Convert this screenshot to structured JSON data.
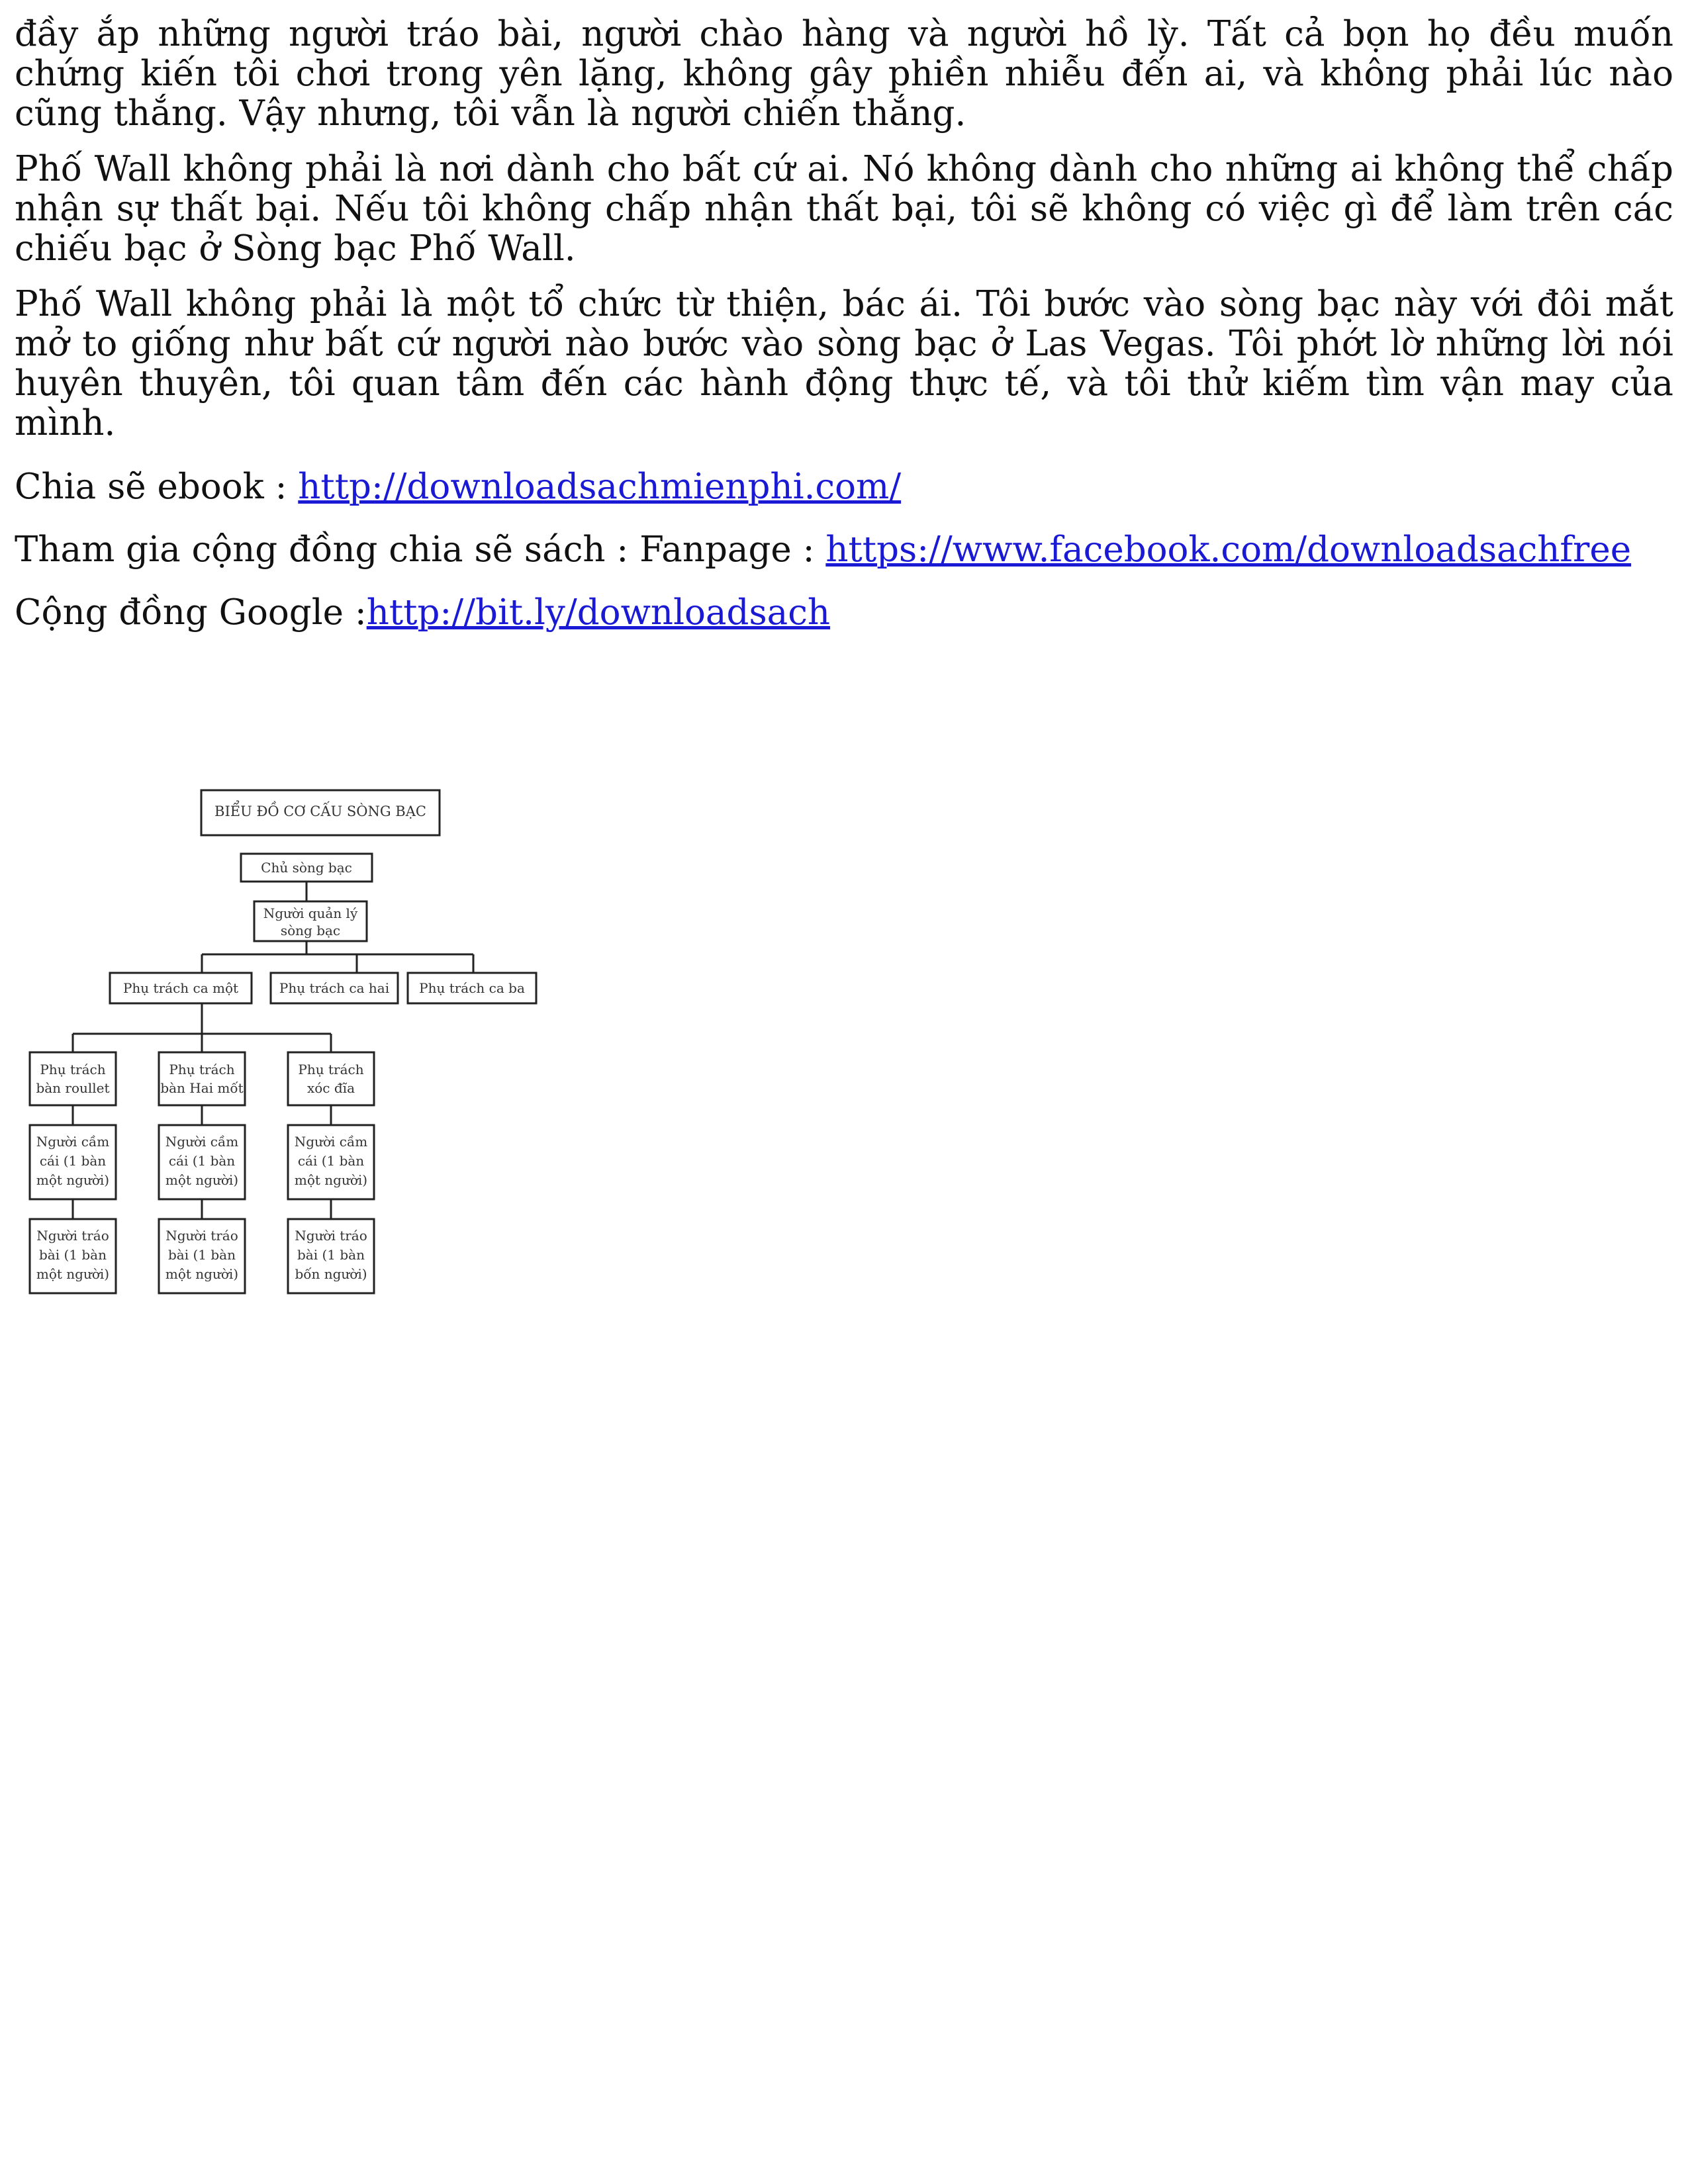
{
  "paragraphs": [
    "đầy ắp những người tráo bài, người chào hàng và người hồ lỳ. Tất cả bọn họ đều muốn chứng kiến tôi chơi trong yên lặng, không gây phiền nhiễu đến ai, và không phải lúc nào cũng thắng. Vậy nhưng, tôi vẫn là người chiến thắng.",
    "Phố Wall không phải là nơi dành cho bất cứ ai. Nó không dành cho những ai không thể chấp nhận sự thất bại. Nếu tôi không chấp nhận thất bại, tôi sẽ không có việc gì để làm trên các chiếu bạc ở Sòng bạc Phố Wall.",
    "Phố Wall không phải là một tổ chức từ thiện, bác ái. Tôi bước vào sòng bạc này với đôi mắt mở to giống như bất cứ người nào bước vào sòng bạc ở Las Vegas. Tôi phớt lờ những lời nói huyên thuyên, tôi quan tâm đến các hành động thực tế, và tôi thử kiếm tìm vận may của mình."
  ],
  "links": [
    {
      "label": "Chia sẽ ebook : ",
      "text": "http://downloadsachmienphi.com/"
    },
    {
      "label": "Tham gia cộng đồng chia sẽ sách : Fanpage : ",
      "text": "https://www.facebook.com/downloadsachfree"
    },
    {
      "label": "Cộng đồng Google :",
      "text": "http://bit.ly/downloadsach"
    }
  ],
  "diagram": {
    "title": "BIỂU ĐỒ CƠ CẤU SÒNG BẠC",
    "owner": "Chủ sòng bạc",
    "manager": [
      "Người quản lý",
      "sòng bạc"
    ],
    "shifts": [
      "Phụ trách ca một",
      "Phụ trách ca hai",
      "Phụ trách ca ba"
    ],
    "tables": [
      [
        "Phụ trách",
        "bàn roullet"
      ],
      [
        "Phụ trách",
        "bàn Hai mốt"
      ],
      [
        "Phụ trách",
        "xóc đĩa"
      ]
    ],
    "dealers": [
      [
        "Người cầm",
        "cái (1 bàn",
        "một người)"
      ],
      [
        "Người cầm",
        "cái (1 bàn",
        "một người)"
      ],
      [
        "Người cầm",
        "cái (1 bàn",
        "một người)"
      ]
    ],
    "shufflers": [
      [
        "Người tráo",
        "bài (1 bàn",
        "một người)"
      ],
      [
        "Người tráo",
        "bài (1 bàn",
        "một người)"
      ],
      [
        "Người tráo",
        "bài (1 bàn",
        "bốn người)"
      ]
    ]
  }
}
